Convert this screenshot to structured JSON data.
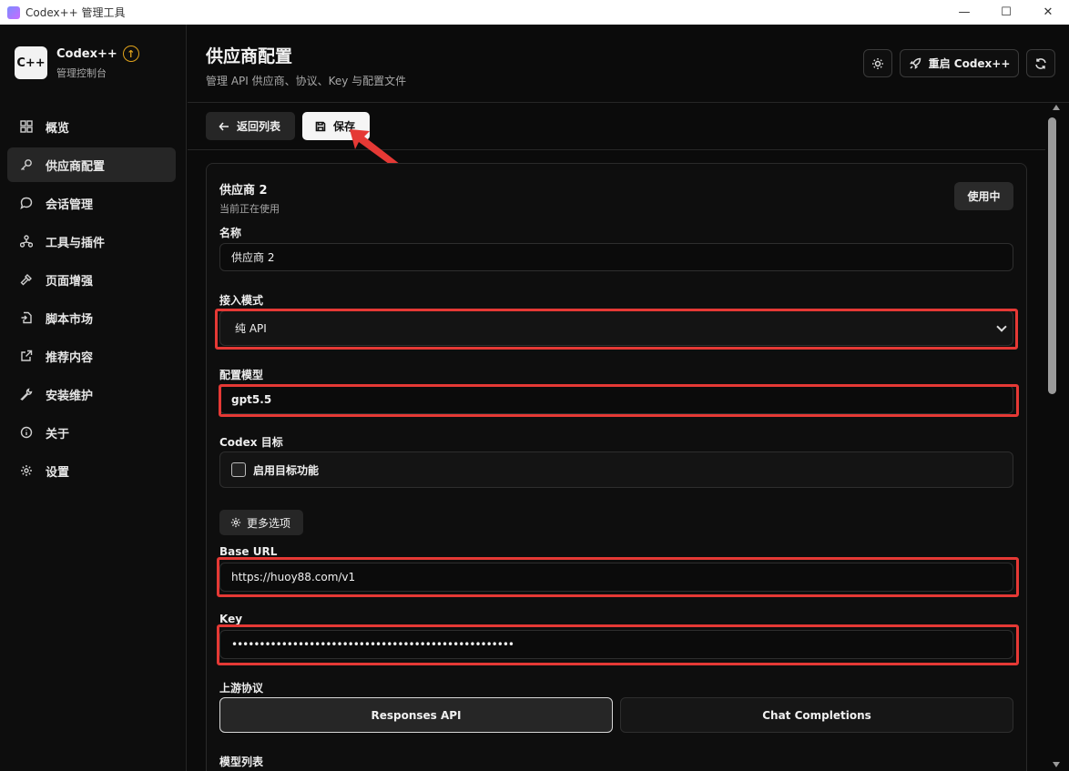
{
  "window": {
    "title": "Codex++ 管理工具",
    "minimize": "—",
    "maximize": "☐",
    "close": "✕"
  },
  "brand": {
    "logo": "C++",
    "name": "Codex++",
    "subtitle": "管理控制台"
  },
  "sidebar": {
    "items": [
      {
        "label": "概览",
        "icon": "grid-icon"
      },
      {
        "label": "供应商配置",
        "icon": "key-icon",
        "active": true
      },
      {
        "label": "会话管理",
        "icon": "chat-icon"
      },
      {
        "label": "工具与插件",
        "icon": "network-icon"
      },
      {
        "label": "页面增强",
        "icon": "hammer-icon"
      },
      {
        "label": "脚本市场",
        "icon": "file-import-icon"
      },
      {
        "label": "推荐内容",
        "icon": "external-link-icon"
      },
      {
        "label": "安装维护",
        "icon": "wrench-icon"
      },
      {
        "label": "关于",
        "icon": "info-icon"
      },
      {
        "label": "设置",
        "icon": "gear-icon"
      }
    ]
  },
  "header": {
    "title": "供应商配置",
    "subtitle": "管理 API 供应商、协议、Key 与配置文件",
    "restart_label": "重启 Codex++"
  },
  "toolbar": {
    "back_label": "返回列表",
    "save_label": "保存"
  },
  "card": {
    "title": "供应商 2",
    "subtitle": "当前正在使用",
    "in_use_label": "使用中",
    "name_label": "名称",
    "name_value": "供应商 2",
    "mode_label": "接入模式",
    "mode_value": "纯 API",
    "model_label": "配置模型",
    "model_value": "gpt5.5",
    "target_label": "Codex 目标",
    "target_checkbox_label": "启用目标功能",
    "more_options_label": "更多选项",
    "base_url_label": "Base URL",
    "base_url_value": "https://huoy88.com/v1",
    "key_label": "Key",
    "key_value": "•••••••••••••••••••••••••••••••••••••••••••••••••••",
    "protocol_label": "上游协议",
    "protocol_options": [
      "Responses API",
      "Chat Completions"
    ],
    "protocol_selected": "Responses API",
    "model_list_label": "模型列表"
  },
  "colors": {
    "accent_red": "#e53935",
    "upgrade_badge": "#e0a21b"
  }
}
